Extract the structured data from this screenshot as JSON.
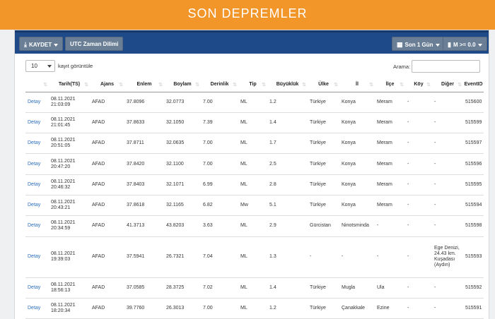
{
  "banner": {
    "title": "SON DEPREMLER"
  },
  "toolbar": {
    "save_label": "KAYDET",
    "utc_label": "UTC Zaman Dilimi",
    "period_label": "Son 1 Gün",
    "magnitude_label": "M >= 0.0"
  },
  "controls": {
    "page_length_value": "10",
    "page_length_label": "kayıt görüntüle",
    "search_label": "Arama:",
    "search_value": ""
  },
  "table": {
    "headers": [
      "",
      "Tarih(TS)",
      "Ajans",
      "Enlem",
      "Boylam",
      "Derinlik",
      "Tip",
      "Büyüklük",
      "Ülke",
      "İl",
      "İlçe",
      "Köy",
      "Diğer",
      "EventID"
    ],
    "rows": [
      {
        "detail": "Detay",
        "date": "08.11.2021",
        "time": "21:03:09",
        "agency": "AFAD",
        "lat": "37.8096",
        "lon": "32.0773",
        "depth": "7.00",
        "type": "ML",
        "mag": "1.2",
        "country": "Türkiye",
        "province": "Konya",
        "district": "Meram",
        "village": "-",
        "other": "-",
        "event_id": "515600"
      },
      {
        "detail": "Detay",
        "date": "08.11.2021",
        "time": "21:01:45",
        "agency": "AFAD",
        "lat": "37.8633",
        "lon": "32.1050",
        "depth": "7.39",
        "type": "ML",
        "mag": "1.4",
        "country": "Türkiye",
        "province": "Konya",
        "district": "Meram",
        "village": "-",
        "other": "-",
        "event_id": "515599"
      },
      {
        "detail": "Detay",
        "date": "08.11.2021",
        "time": "20:51:05",
        "agency": "AFAD",
        "lat": "37.8711",
        "lon": "32.0635",
        "depth": "7.00",
        "type": "ML",
        "mag": "1.7",
        "country": "Türkiye",
        "province": "Konya",
        "district": "Meram",
        "village": "-",
        "other": "-",
        "event_id": "515597"
      },
      {
        "detail": "Detay",
        "date": "08.11.2021",
        "time": "20:47:20",
        "agency": "AFAD",
        "lat": "37.8420",
        "lon": "32.1100",
        "depth": "7.00",
        "type": "ML",
        "mag": "2.5",
        "country": "Türkiye",
        "province": "Konya",
        "district": "Meram",
        "village": "-",
        "other": "-",
        "event_id": "515596"
      },
      {
        "detail": "Detay",
        "date": "08.11.2021",
        "time": "20:46:32",
        "agency": "AFAD",
        "lat": "37.8403",
        "lon": "32.1071",
        "depth": "6.99",
        "type": "ML",
        "mag": "2.8",
        "country": "Türkiye",
        "province": "Konya",
        "district": "Meram",
        "village": "-",
        "other": "-",
        "event_id": "515595"
      },
      {
        "detail": "Detay",
        "date": "08.11.2021",
        "time": "20:43:21",
        "agency": "AFAD",
        "lat": "37.8618",
        "lon": "32.1165",
        "depth": "6.82",
        "type": "Mw",
        "mag": "5.1",
        "country": "Türkiye",
        "province": "Konya",
        "district": "Meram",
        "village": "-",
        "other": "-",
        "event_id": "515594"
      },
      {
        "detail": "Detay",
        "date": "08.11.2021",
        "time": "20:34:59",
        "agency": "AFAD",
        "lat": "41.3713",
        "lon": "43.8203",
        "depth": "3.63",
        "type": "ML",
        "mag": "2.9",
        "country": "Gürcistan",
        "province": "Ninotsminda",
        "district": "-",
        "village": "-",
        "other": "-",
        "event_id": "515598"
      },
      {
        "detail": "Detay",
        "date": "08.11.2021",
        "time": "19:39:03",
        "agency": "AFAD",
        "lat": "37.5941",
        "lon": "26.7321",
        "depth": "7.04",
        "type": "ML",
        "mag": "1.3",
        "country": "-",
        "province": "-",
        "district": "-",
        "village": "-",
        "other": "Ege Denizi, 24.43 km. Kuşadası (Aydın)",
        "event_id": "515593"
      },
      {
        "detail": "Detay",
        "date": "08.11.2021",
        "time": "18:56:13",
        "agency": "AFAD",
        "lat": "37.0585",
        "lon": "28.3725",
        "depth": "7.02",
        "type": "ML",
        "mag": "1.4",
        "country": "Türkiye",
        "province": "Mugla",
        "district": "Ula",
        "village": "-",
        "other": "-",
        "event_id": "515592"
      },
      {
        "detail": "Detay",
        "date": "08.11.2021",
        "time": "18:20:34",
        "agency": "AFAD",
        "lat": "39.7760",
        "lon": "26.3013",
        "depth": "7.00",
        "type": "ML",
        "mag": "1.2",
        "country": "Türkiye",
        "province": "Çanakkale",
        "district": "Ezine",
        "village": "-",
        "other": "-",
        "event_id": "515591"
      }
    ]
  }
}
